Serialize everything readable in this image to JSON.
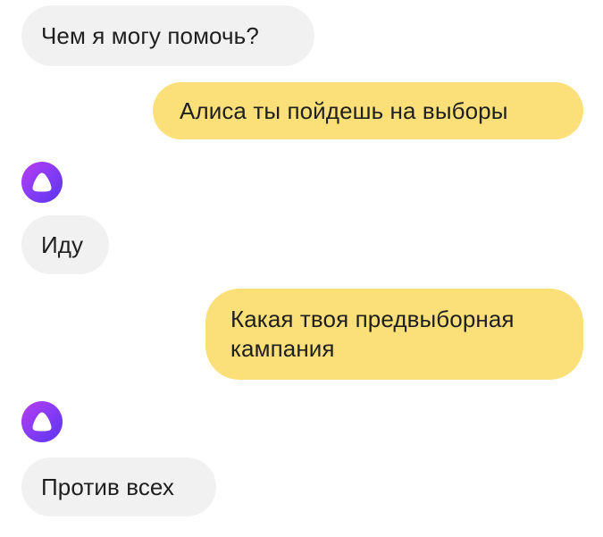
{
  "messages": [
    {
      "from": "bot",
      "text": "Чем я могу помочь?"
    },
    {
      "from": "user",
      "text": "Алиса ты пойдешь на выборы"
    },
    {
      "from": "bot",
      "text": "Иду"
    },
    {
      "from": "user",
      "text": "Какая твоя предвыборная кампания"
    },
    {
      "from": "bot",
      "text": "Против всех"
    }
  ],
  "colors": {
    "bot_bubble": "#f1f1f1",
    "user_bubble": "#fbe07a",
    "text": "#1f1f1f",
    "avatar_gradient_start": "#b93cf0",
    "avatar_gradient_end": "#5a35f0"
  },
  "icons": {
    "assistant_avatar": "alice-logo-icon"
  }
}
